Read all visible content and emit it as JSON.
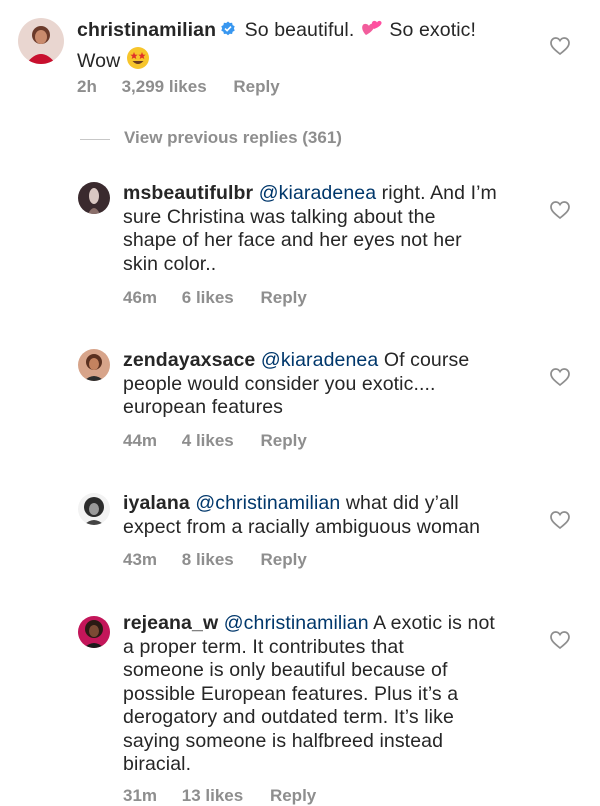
{
  "top_comment": {
    "username": "christinamilian",
    "text_before_emoji": " So beautiful. ",
    "text_middle": " So exotic!",
    "text_line2": "Wow ",
    "time": "2h",
    "likes": "3,299 likes",
    "reply": "Reply"
  },
  "view_previous": "View previous replies (361)",
  "replies": [
    {
      "username": "msbeautifulbr",
      "mention": "@kiaradenea",
      "lines": [
        " right. And I’m",
        "sure Christina was talking about the",
        "shape of her face and her eyes not her",
        "skin color.."
      ],
      "time": "46m",
      "likes": "6 likes",
      "reply": "Reply"
    },
    {
      "username": "zendayaxsace",
      "mention": "@kiaradenea",
      "lines": [
        " Of course",
        "people would consider you exotic....",
        "european features"
      ],
      "time": "44m",
      "likes": "4 likes",
      "reply": "Reply"
    },
    {
      "username": "iyalana",
      "mention": "@christinamilian",
      "lines": [
        " what did y’all",
        "expect from a racially ambiguous woman"
      ],
      "time": "43m",
      "likes": "8 likes",
      "reply": "Reply"
    },
    {
      "username": "rejeana_w",
      "mention": "@christinamilian",
      "lines": [
        " A exotic is not",
        "a proper term. It contributes that",
        "someone is only beautiful because of",
        "possible European features. Plus it’s a",
        "derogatory and outdated term. It’s like",
        "saying someone is halfbreed instead",
        "biracial."
      ],
      "time": "31m",
      "likes": "13 likes",
      "reply": "Reply"
    }
  ],
  "colors": {
    "text": "#262626",
    "meta": "#8e8e8e",
    "mention": "#00376b",
    "verified": "#3897f0"
  },
  "icons": [
    "heart-icon",
    "verified-badge-icon",
    "two-hearts-emoji",
    "star-struck-emoji"
  ]
}
